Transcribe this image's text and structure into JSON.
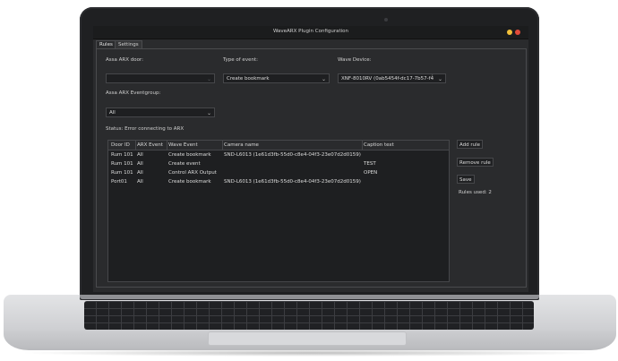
{
  "window": {
    "title": "WaveARX Plugin Configuration"
  },
  "tabs": [
    {
      "label": "Rules",
      "active": true
    },
    {
      "label": "Settings",
      "active": false
    }
  ],
  "form": {
    "door_label": "Assa ARX door:",
    "door_value": "",
    "event_type_label": "Type of event:",
    "event_type_value": "Create bookmark",
    "wave_device_label": "Wave Device:",
    "wave_device_value": "XNF-8010RV (0ab5454f-dc17-7b57-f4́",
    "eventgroup_label": "Assa ARX Eventgroup:",
    "eventgroup_value": "All"
  },
  "status": "Status: Error connecting to ARX",
  "table": {
    "columns": [
      "Door ID",
      "ARX Event",
      "Wave Event",
      "Camera name",
      "Caption text"
    ],
    "rows": [
      [
        "Rum 101",
        "All",
        "Create bookmark",
        "SND-L6013 (1e61d3fb-55d0-c8e4-04f3-23e07d2d0159)",
        ""
      ],
      [
        "Rum 101",
        "All",
        "Create event",
        "",
        "TEST"
      ],
      [
        "Rum 101",
        "All",
        "Control ARX Output",
        "",
        "OPEN"
      ],
      [
        "Port01",
        "All",
        "Create bookmark",
        "SND-L6013 (1e61d3fb-55d0-c8e4-04f3-23e07d2d0159)",
        ""
      ]
    ]
  },
  "buttons": {
    "add_rule": "Add rule",
    "remove_rule": "Remove rule",
    "save": "Save"
  },
  "rules_used": "Rules used: 2",
  "icons": {
    "dropdown": "chevron-down-icon"
  },
  "colors": {
    "minimize": "#f2c13a",
    "close": "#e24b3a",
    "window_bg": "#2a2b2d"
  }
}
